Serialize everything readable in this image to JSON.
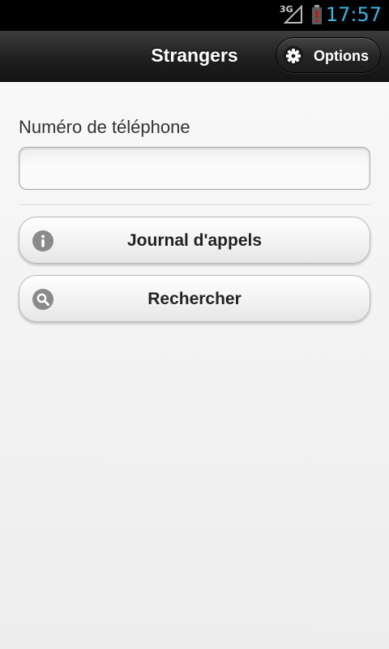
{
  "status_bar": {
    "network": "3G",
    "time": "17:57",
    "signal_icon": "signal-strength-icon",
    "battery_icon": "battery-alert-icon",
    "time_color": "#33b5e5",
    "battery_alert_color": "#d01010"
  },
  "header": {
    "title": "Strangers",
    "options_label": "Options",
    "options_icon": "gear-icon"
  },
  "form": {
    "phone_label": "Numéro de téléphone",
    "phone_value": ""
  },
  "actions": {
    "journal_label": "Journal d'appels",
    "journal_icon": "info-icon",
    "search_label": "Rechercher",
    "search_icon": "search-icon"
  }
}
